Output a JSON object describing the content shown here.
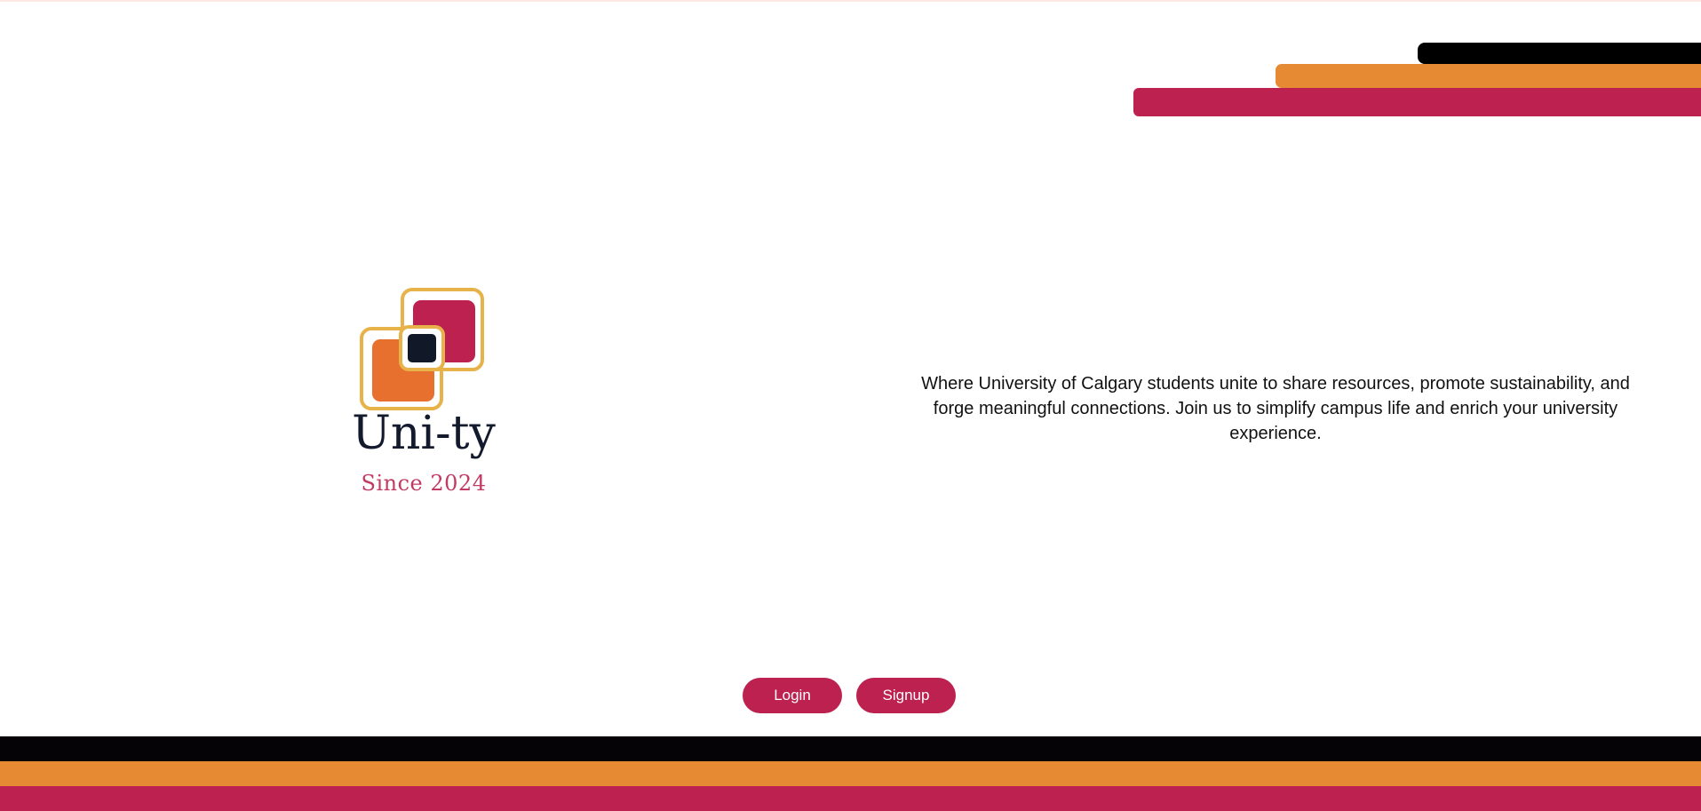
{
  "brand": {
    "name": "Uni-ty",
    "since": "Since 2024",
    "logo_icon": "overlapping-squares-logo-icon"
  },
  "hero": {
    "tagline": "Where University of Calgary students unite to share resources, promote sustainability, and forge meaningful connections. Join us to simplify campus life and enrich your university experience."
  },
  "actions": {
    "login_label": "Login",
    "signup_label": "Signup"
  },
  "colors": {
    "primary": "#bc2150",
    "accent": "#e68a33",
    "dark": "#000000",
    "logo_outline": "#e8b24a",
    "logo_center": "#111827"
  }
}
